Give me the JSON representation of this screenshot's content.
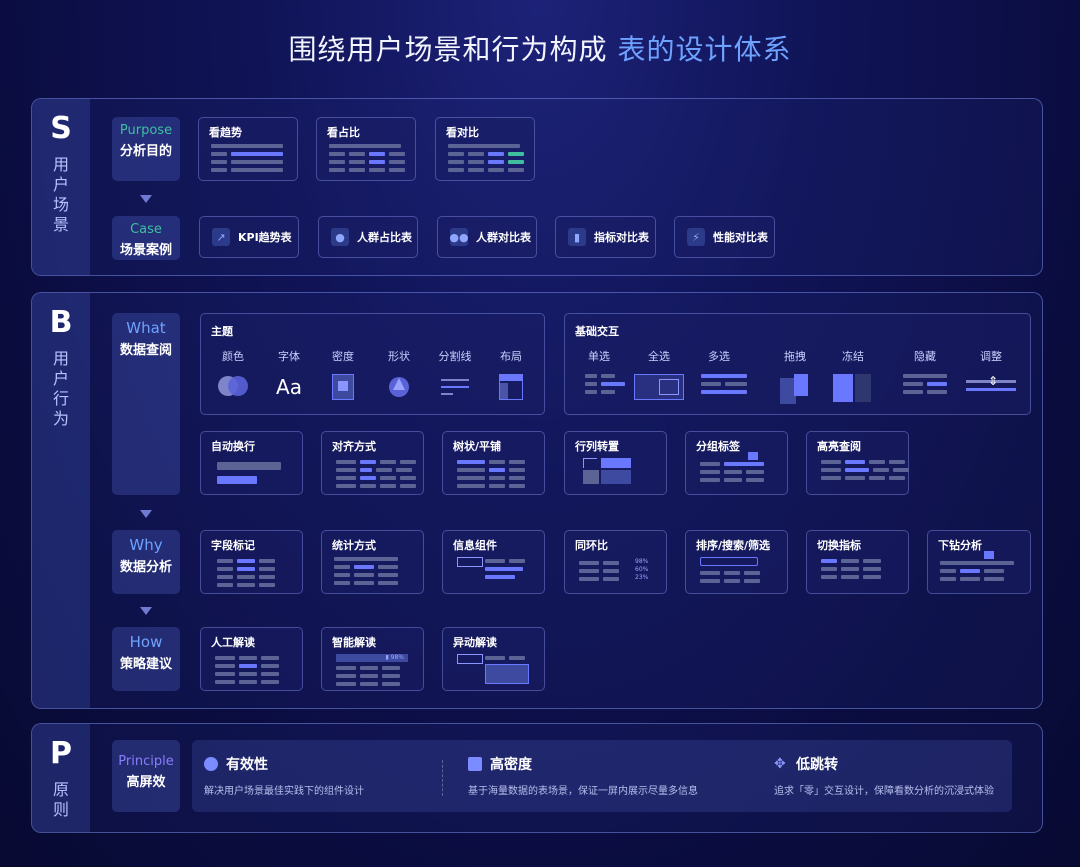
{
  "title": {
    "main": "围绕用户场景和行为构成",
    "highlight": "表的设计体系"
  },
  "colors": {
    "purpose": "#3fbfa0",
    "what": "#6ea2ff",
    "why": "#6ea2ff",
    "how": "#6ea2ff",
    "principle": "#8a7cff",
    "highlight": "#6ea2ff"
  },
  "s": {
    "letter": "S",
    "name": "用户场景",
    "purpose": {
      "en": "Purpose",
      "zh": "分析目的"
    },
    "case": {
      "en": "Case",
      "zh": "场景案例"
    },
    "purpose_cards": [
      "看趋势",
      "看占比",
      "看对比"
    ],
    "cases": [
      {
        "icon": "trend-icon",
        "label": "KPI趋势表"
      },
      {
        "icon": "user-icon",
        "label": "人群占比表"
      },
      {
        "icon": "users-icon",
        "label": "人群对比表"
      },
      {
        "icon": "bar-icon",
        "label": "指标对比表"
      },
      {
        "icon": "bolt-icon",
        "label": "性能对比表"
      }
    ]
  },
  "b": {
    "letter": "B",
    "name": "用户行为",
    "what": {
      "en": "What",
      "zh": "数据查阅"
    },
    "why": {
      "en": "Why",
      "zh": "数据分析"
    },
    "how": {
      "en": "How",
      "zh": "策略建议"
    },
    "theme": {
      "title": "主题",
      "items": [
        "颜色",
        "字体",
        "密度",
        "形状",
        "分割线",
        "布局"
      ],
      "font_sample": "Aa"
    },
    "interaction": {
      "title": "基础交互",
      "items": [
        "单选",
        "全选",
        "多选",
        "拖拽",
        "冻结",
        "隐藏",
        "调整"
      ]
    },
    "what_cards": [
      "自动换行",
      "对齐方式",
      "树状/平铺",
      "行列转置",
      "分组标签",
      "高亮查阅"
    ],
    "why_cards": [
      "字段标记",
      "统计方式",
      "信息组件",
      "同环比",
      "排序/搜索/筛选",
      "切换指标",
      "下钻分析"
    ],
    "how_cards": [
      "人工解读",
      "智能解读",
      "异动解读"
    ],
    "yoy_values": [
      "98%",
      "60%",
      "23%"
    ],
    "smart_badge": "▮ 98%"
  },
  "p": {
    "letter": "P",
    "name": "原则",
    "principle": {
      "en": "Principle",
      "zh": "高屏效"
    },
    "items": [
      {
        "icon": "user-icon",
        "title": "有效性",
        "desc": "解决用户场景最佳实践下的组件设计"
      },
      {
        "icon": "grid-icon",
        "title": "高密度",
        "desc": "基于海量数据的表场景，保证一屏内展示尽量多信息"
      },
      {
        "icon": "move-icon",
        "title": "低跳转",
        "desc": "追求「零」交互设计，保障看数分析的沉浸式体验"
      }
    ]
  }
}
